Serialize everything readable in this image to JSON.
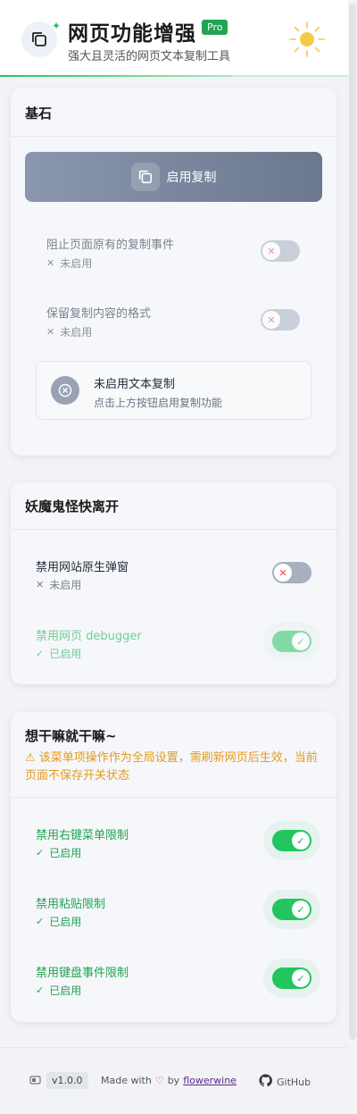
{
  "header": {
    "title": "网页功能增强",
    "badge": "Pro",
    "subtitle": "强大且灵活的网页文本复制工具",
    "icons": {
      "logo": "copy-icon",
      "theme": "sun-icon"
    }
  },
  "section1": {
    "title": "基石",
    "main_button": "启用复制",
    "items": [
      {
        "label": "阻止页面原有的复制事件",
        "status": "未启用",
        "enabled": false
      },
      {
        "label": "保留复制内容的格式",
        "status": "未启用",
        "enabled": false
      }
    ],
    "info": {
      "title": "未启用文本复制",
      "desc": "点击上方按钮启用复制功能"
    }
  },
  "section2": {
    "title": "妖魔鬼怪快离开",
    "items": [
      {
        "label": "禁用网站原生弹窗",
        "status": "未启用",
        "enabled": false
      },
      {
        "label": "禁用网页 debugger",
        "status": "已启用",
        "enabled": true
      }
    ]
  },
  "section3": {
    "title": "想干嘛就干嘛~",
    "warning": "该菜单项操作作为全局设置，需刷新网页后生效，当前页面不保存开关状态",
    "items": [
      {
        "label": "禁用右键菜单限制",
        "status": "已启用",
        "enabled": true
      },
      {
        "label": "禁用粘贴限制",
        "status": "已启用",
        "enabled": true
      },
      {
        "label": "禁用键盘事件限制",
        "status": "已启用",
        "enabled": true
      }
    ]
  },
  "footer": {
    "version": "v1.0.0",
    "made_with": "Made with",
    "by": "by",
    "author": "flowerwine",
    "github": "GitHub"
  },
  "colors": {
    "accent": "#22c55e",
    "disabled_toggle": "#a7afc0",
    "warning": "#e29a1b"
  }
}
